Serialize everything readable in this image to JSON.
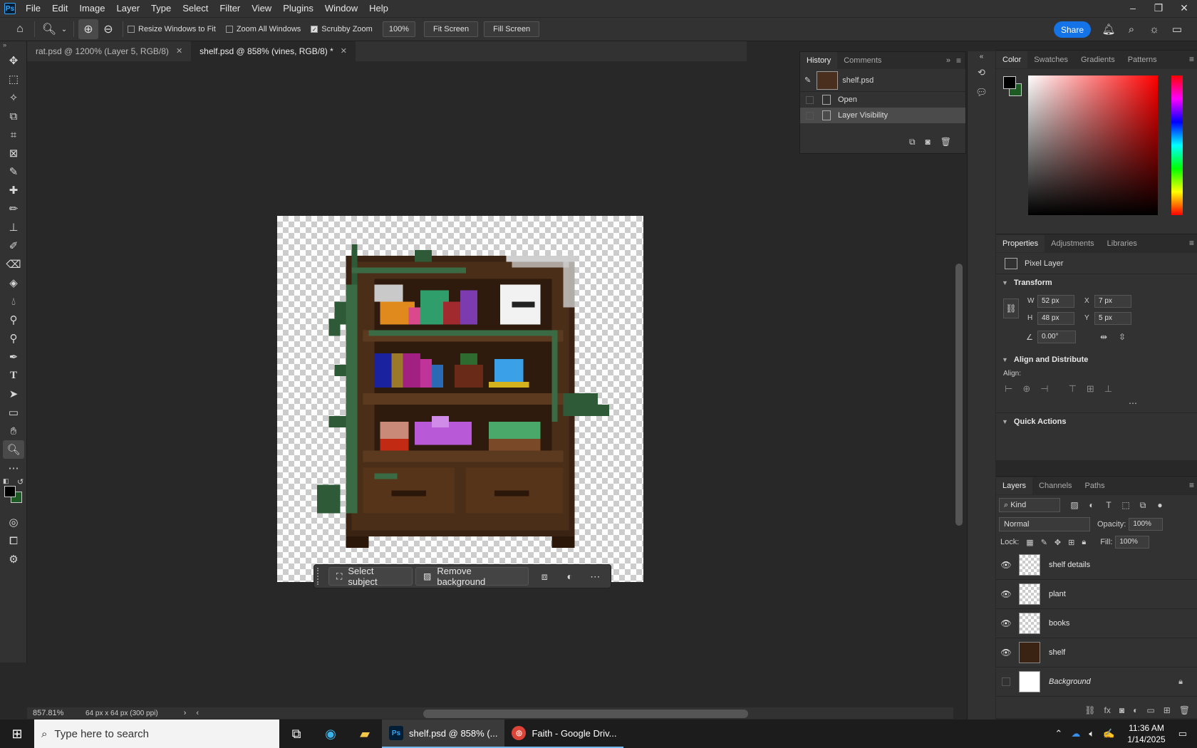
{
  "menubar": {
    "logo": "Ps",
    "items": [
      "File",
      "Edit",
      "Image",
      "Layer",
      "Type",
      "Select",
      "Filter",
      "View",
      "Plugins",
      "Window",
      "Help"
    ]
  },
  "options": {
    "resize_windows": "Resize Windows to Fit",
    "zoom_all": "Zoom All Windows",
    "scrubby": "Scrubby Zoom",
    "zoom_value": "100%",
    "fit_screen": "Fit Screen",
    "fill_screen": "Fill Screen",
    "share": "Share"
  },
  "tabs": [
    {
      "label": "rat.psd @ 1200% (Layer 5, RGB/8)"
    },
    {
      "label": "shelf.psd @ 858% (vines, RGB/8) *"
    }
  ],
  "history": {
    "tabs": [
      "History",
      "Comments"
    ],
    "snapshot": "shelf.psd",
    "steps": [
      "Open",
      "Layer Visibility"
    ]
  },
  "context_bar": {
    "select_subject": "Select subject",
    "remove_background": "Remove background"
  },
  "status": {
    "zoom": "857.81%",
    "doc_info": "64 px x 64 px (300 ppi)"
  },
  "color_panel": {
    "tabs": [
      "Color",
      "Swatches",
      "Gradients",
      "Patterns"
    ],
    "foreground": "#000000",
    "background": "#1d5a24"
  },
  "properties": {
    "tabs": [
      "Properties",
      "Adjustments",
      "Libraries"
    ],
    "layer_type": "Pixel Layer",
    "transform_title": "Transform",
    "w_label": "W",
    "w": "52 px",
    "h_label": "H",
    "h": "48 px",
    "x_label": "X",
    "x": "7 px",
    "y_label": "Y",
    "y": "5 px",
    "angle": "0.00°",
    "align_title": "Align and Distribute",
    "align_label": "Align:",
    "quick_actions": "Quick Actions"
  },
  "layers": {
    "tabs": [
      "Layers",
      "Channels",
      "Paths"
    ],
    "kind": "Kind",
    "blend_mode": "Normal",
    "opacity_label": "Opacity:",
    "opacity": "100%",
    "lock_label": "Lock:",
    "fill_label": "Fill:",
    "fill": "100%",
    "items": [
      {
        "name": "shelf details"
      },
      {
        "name": "plant"
      },
      {
        "name": "books"
      },
      {
        "name": "shelf"
      },
      {
        "name": "Background"
      }
    ]
  },
  "taskbar": {
    "search_placeholder": "Type here to search",
    "apps": [
      {
        "label": "shelf.psd @ 858% (..."
      },
      {
        "label": "Faith - Google Driv..."
      }
    ],
    "time": "11:36 AM",
    "date": "1/14/2025"
  }
}
